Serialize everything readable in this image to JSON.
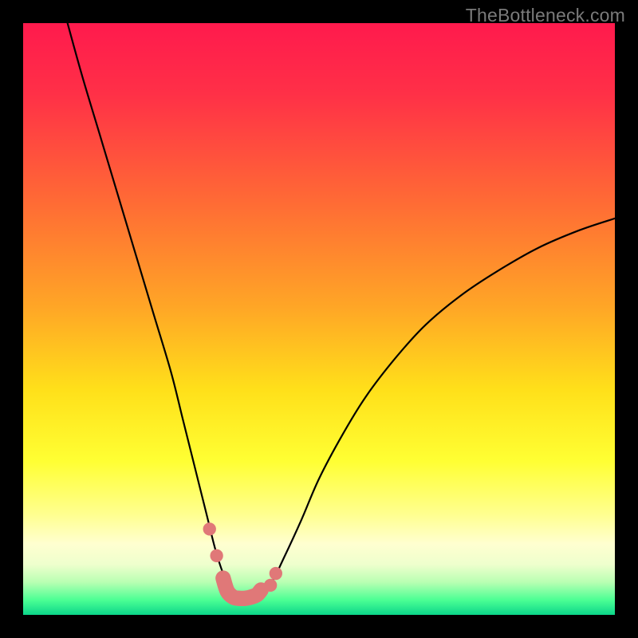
{
  "watermark": "TheBottleneck.com",
  "chart_data": {
    "type": "line",
    "title": "",
    "xlabel": "",
    "ylabel": "",
    "xlim": [
      0,
      100
    ],
    "ylim": [
      0,
      100
    ],
    "axes_visible": false,
    "background": {
      "type": "vertical-gradient",
      "stops": [
        {
          "pos": 0.0,
          "color": "#ff1a4d"
        },
        {
          "pos": 0.12,
          "color": "#ff3047"
        },
        {
          "pos": 0.3,
          "color": "#ff6a35"
        },
        {
          "pos": 0.48,
          "color": "#ffa626"
        },
        {
          "pos": 0.62,
          "color": "#ffe01a"
        },
        {
          "pos": 0.74,
          "color": "#ffff33"
        },
        {
          "pos": 0.83,
          "color": "#ffff8f"
        },
        {
          "pos": 0.88,
          "color": "#ffffd0"
        },
        {
          "pos": 0.915,
          "color": "#eeffcd"
        },
        {
          "pos": 0.945,
          "color": "#b8ffb2"
        },
        {
          "pos": 0.975,
          "color": "#4bff94"
        },
        {
          "pos": 1.0,
          "color": "#0cd68a"
        }
      ]
    },
    "series": [
      {
        "name": "bottleneck-curve",
        "stroke": "#000000",
        "stroke_width": 2.2,
        "x": [
          7.5,
          10,
          13,
          16,
          19,
          22,
          25,
          27,
          29,
          31,
          32.5,
          34,
          35.5,
          37,
          38,
          40,
          42,
          44,
          47,
          50,
          54,
          58,
          63,
          68,
          74,
          80,
          87,
          94,
          100
        ],
        "y": [
          100,
          91,
          81,
          71,
          61,
          51,
          41,
          33,
          25,
          17,
          11,
          6.5,
          4.0,
          3.0,
          3.0,
          3.5,
          5.5,
          9.5,
          16,
          23,
          30.5,
          37,
          43.5,
          49,
          54,
          58,
          62,
          65,
          67
        ]
      }
    ],
    "markers": [
      {
        "name": "marker-left-upper",
        "x": 31.5,
        "y": 14.5,
        "r": 1.1,
        "color": "#e07878"
      },
      {
        "name": "marker-left-lower",
        "x": 32.7,
        "y": 10.0,
        "r": 1.1,
        "color": "#e07878"
      },
      {
        "name": "marker-right-upper",
        "x": 42.7,
        "y": 7.0,
        "r": 1.1,
        "color": "#e07878"
      },
      {
        "name": "marker-right-lower",
        "x": 41.8,
        "y": 5.0,
        "r": 1.1,
        "color": "#e07878"
      }
    ],
    "trough_segment": {
      "name": "trough-band",
      "color": "#e07878",
      "width": 2.6,
      "x": [
        33.8,
        34.5,
        35.5,
        36.5,
        37.5,
        38.5,
        39.5,
        40.2
      ],
      "y": [
        6.2,
        4.0,
        3.0,
        2.8,
        2.8,
        3.0,
        3.4,
        4.2
      ]
    }
  }
}
